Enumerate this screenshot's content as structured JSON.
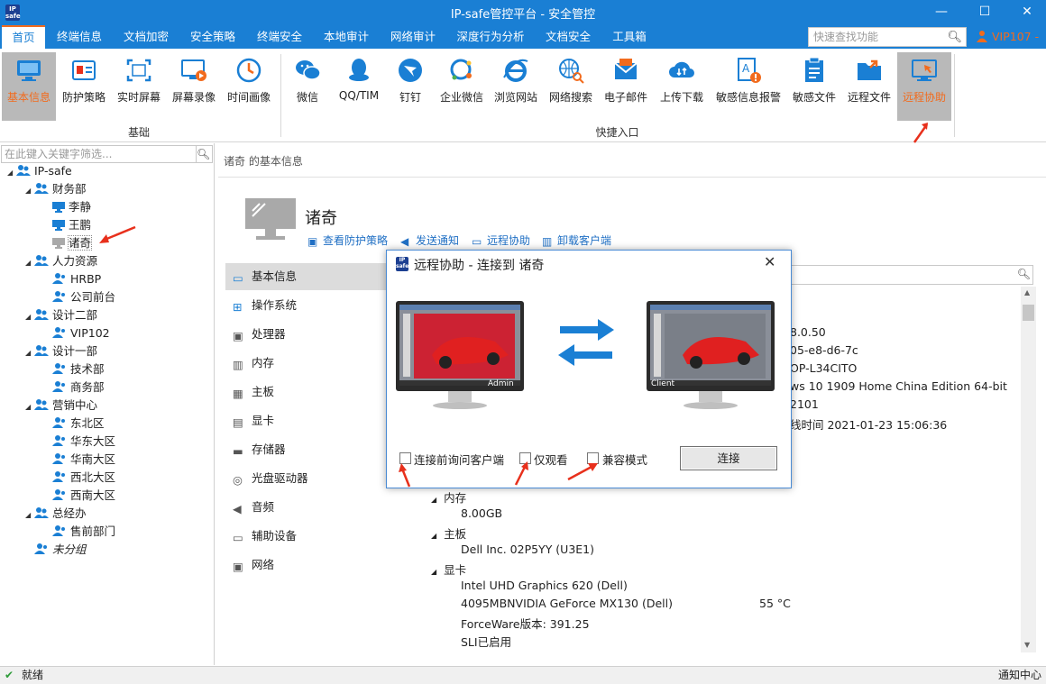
{
  "window": {
    "logo_text": "IP safe",
    "title": "IP-safe管控平台 - 安全管控",
    "min_glyph": "—",
    "max_glyph": "☐",
    "close_glyph": "✕"
  },
  "menu": {
    "items": [
      "首页",
      "终端信息",
      "文档加密",
      "安全策略",
      "终端安全",
      "本地审计",
      "网络审计",
      "深度行为分析",
      "文档安全",
      "工具箱"
    ],
    "search_placeholder": "快速查找功能",
    "user": "VIP107 -"
  },
  "ribbon": {
    "group_basic": "基础",
    "group_quick": "快捷入口",
    "buttons": [
      {
        "label": "基本信息",
        "icon": "monitor-icon"
      },
      {
        "label": "防护策略",
        "icon": "shield-id-icon"
      },
      {
        "label": "实时屏幕",
        "icon": "screen-capture-icon"
      },
      {
        "label": "屏幕录像",
        "icon": "screen-record-icon"
      },
      {
        "label": "时间画像",
        "icon": "clock-icon"
      },
      {
        "label": "微信",
        "icon": "wechat-icon"
      },
      {
        "label": "QQ/TIM",
        "icon": "qq-icon"
      },
      {
        "label": "钉钉",
        "icon": "dingtalk-icon"
      },
      {
        "label": "企业微信",
        "icon": "wecom-icon"
      },
      {
        "label": "浏览网站",
        "icon": "ie-icon"
      },
      {
        "label": "网络搜索",
        "icon": "globe-search-icon"
      },
      {
        "label": "电子邮件",
        "icon": "email-icon"
      },
      {
        "label": "上传下载",
        "icon": "cloud-transfer-icon"
      },
      {
        "label": "敏感信息报警",
        "icon": "alert-doc-icon"
      },
      {
        "label": "敏感文件",
        "icon": "sensitive-file-icon"
      },
      {
        "label": "远程文件",
        "icon": "remote-folder-icon"
      },
      {
        "label": "远程协助",
        "icon": "remote-assist-icon"
      }
    ]
  },
  "tree": {
    "filter_placeholder": "在此键入关键字筛选...",
    "nodes": [
      {
        "label": "IP-safe",
        "level": 0,
        "type": "group"
      },
      {
        "label": "财务部",
        "level": 1,
        "type": "group"
      },
      {
        "label": "李静",
        "level": 2,
        "type": "computer"
      },
      {
        "label": "王鹏",
        "level": 2,
        "type": "computer"
      },
      {
        "label": "诸奇",
        "level": 2,
        "type": "computer-offline"
      },
      {
        "label": "人力资源",
        "level": 1,
        "type": "group"
      },
      {
        "label": "HRBP",
        "level": 2,
        "type": "user"
      },
      {
        "label": "公司前台",
        "level": 2,
        "type": "user"
      },
      {
        "label": "设计二部",
        "level": 1,
        "type": "group"
      },
      {
        "label": "VIP102",
        "level": 2,
        "type": "user"
      },
      {
        "label": "设计一部",
        "level": 1,
        "type": "group"
      },
      {
        "label": "技术部",
        "level": 2,
        "type": "user"
      },
      {
        "label": "商务部",
        "level": 2,
        "type": "user"
      },
      {
        "label": "营销中心",
        "level": 1,
        "type": "group"
      },
      {
        "label": "东北区",
        "level": 2,
        "type": "user"
      },
      {
        "label": "华东大区",
        "level": 2,
        "type": "user"
      },
      {
        "label": "华南大区",
        "level": 2,
        "type": "user"
      },
      {
        "label": "西北大区",
        "level": 2,
        "type": "user"
      },
      {
        "label": "西南大区",
        "level": 2,
        "type": "user"
      },
      {
        "label": "总经办",
        "level": 1,
        "type": "group"
      },
      {
        "label": "售前部门",
        "level": 2,
        "type": "user"
      },
      {
        "label": "未分组",
        "level": 1,
        "type": "ungrouped"
      }
    ]
  },
  "detail": {
    "breadcrumb": "诸奇 的基本信息",
    "pc_name": "诸奇",
    "actions": [
      "查看防护策略",
      "发送通知",
      "远程协助",
      "卸载客户端"
    ],
    "side": [
      "基本信息",
      "操作系统",
      "处理器",
      "内存",
      "主板",
      "显卡",
      "存储器",
      "光盘驱动器",
      "音频",
      "辅助设备",
      "网络"
    ],
    "info_partial": [
      "8.0.50",
      "05-e8-d6-7c",
      "OP-L34CITO",
      "ws 10 1909 Home China Edition 64-bit",
      "2101",
      "线时间 2021-01-23 15:06:36"
    ],
    "memory_head": "内存",
    "memory_value": "8.00GB",
    "board_head": "主板",
    "board_value": "Dell Inc. 02P5YY (U3E1)",
    "gpu_head": "显卡",
    "gpu_lines": [
      "Intel UHD Graphics 620 (Dell)",
      "4095MBNVIDIA GeForce MX130 (Dell)",
      "ForceWare版本: 391.25",
      "SLI已启用"
    ],
    "gpu_temp": "55 °C"
  },
  "dialog": {
    "title": "远程协助 - 连接到 诸奇",
    "admin_label": "Admin",
    "client_label": "Client",
    "opt_ask": "连接前询问客户端",
    "opt_view": "仅观看",
    "opt_compat": "兼容模式",
    "connect": "连接"
  },
  "status": {
    "ready": "就绪",
    "notify": "通知中心"
  },
  "colors": {
    "titlebar": "#1a7fd4",
    "accent": "#f26b1d",
    "link": "#1f6fc4",
    "annotation_arrow": "#e8301c"
  }
}
